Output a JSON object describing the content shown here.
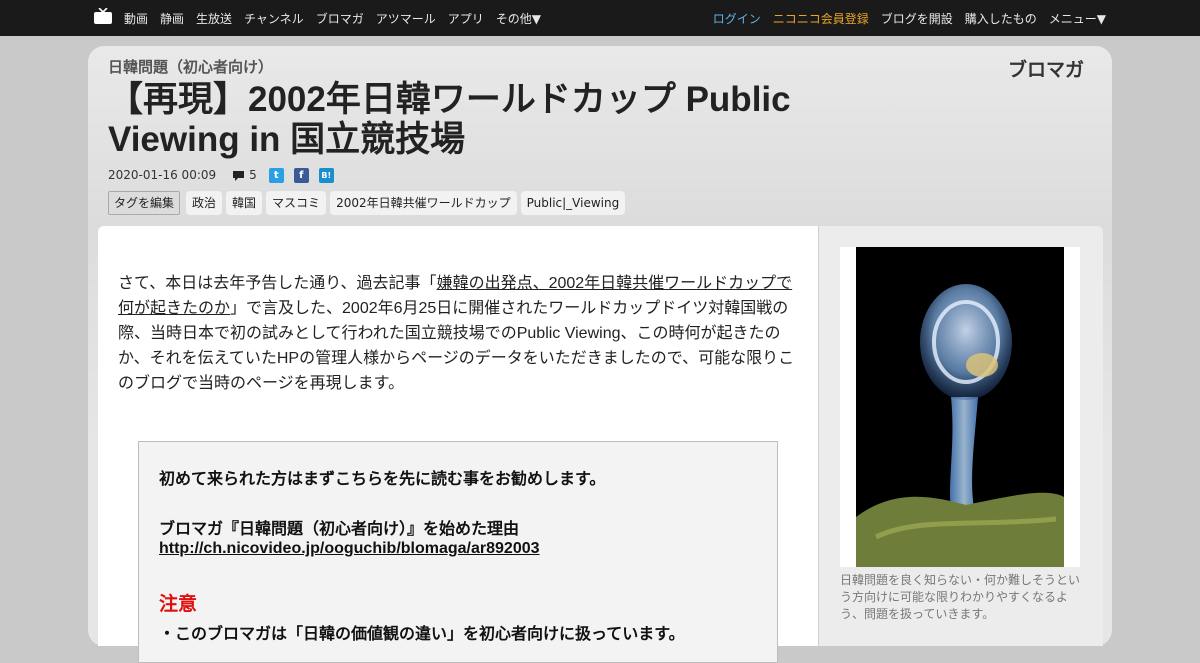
{
  "nav": {
    "left": [
      "動画",
      "静画",
      "生放送",
      "チャンネル",
      "ブロマガ",
      "アツマール",
      "アプリ",
      "その他▼"
    ],
    "login": "ログイン",
    "register": "ニコニコ会員登録",
    "open_blog": "ブログを開設",
    "purchased": "購入したもの",
    "menu": "メニュー▼"
  },
  "blog": {
    "name": "日韓問題（初心者向け）",
    "logo_text": "ブロマガ"
  },
  "article": {
    "title": "【再現】2002年日韓ワールドカップ Public Viewing in 国立競技場",
    "date": "2020-01-16 00:09",
    "comment_count": "5",
    "share": {
      "twitter": "t",
      "facebook": "f",
      "hatena": "B!"
    },
    "tag_edit": "タグを編集",
    "tags": [
      "政治",
      "韓国",
      "マスコミ",
      "2002年日韓共催ワールドカップ",
      "Public|_Viewing"
    ],
    "intro": {
      "before": "さて、本日は去年予告した通り、過去記事「",
      "link": "嫌韓の出発点、2002年日韓共催ワールドカップで何が起きたのか",
      "after": "」で言及した、2002年6月25日に開催されたワールドカップドイツ対韓国戦の際、当時日本で初の試みとして行われた国立競技場でのPublic Viewing、この時何が起きたのか、それを伝えていたHPの管理人様からページのデータをいただきましたので、可能な限りこのブログで当時のページを再現します。"
    },
    "notice": {
      "line1": "初めて来られた方はまずこちらを先に読む事をお勧めします。",
      "line2": "ブロマガ『日韓問題（初心者向け）』を始めた理由",
      "link": "http://ch.nicovideo.jp/ooguchib/blomaga/ar892003",
      "warning": "注意",
      "line3": "・このブロマガは「日韓の価値観の違い」を初心者向けに扱っています。"
    }
  },
  "sidebar": {
    "description": "日韓問題を良く知らない・何か難しそうという方向けに可能な限りわかりやすくなるよう、問題を扱っていきます。"
  }
}
